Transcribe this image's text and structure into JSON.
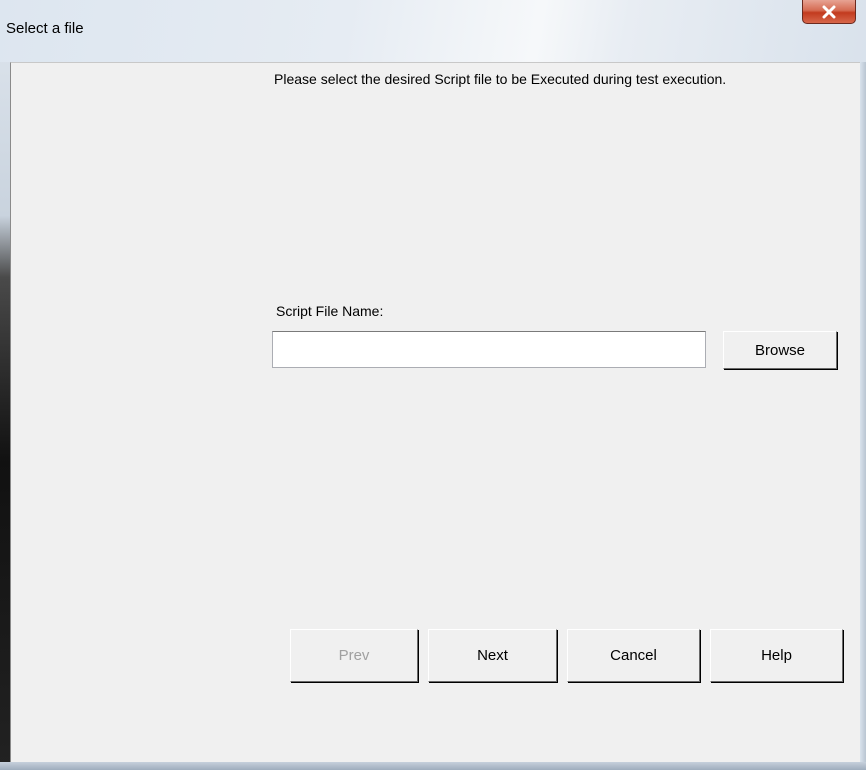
{
  "window": {
    "title": "Select a file",
    "close_icon": "close-icon"
  },
  "main": {
    "instructions": "Please select the desired Script file to be Executed during test execution.",
    "script_file": {
      "label": "Script File Name:",
      "value": "",
      "placeholder": ""
    },
    "browse_label": "Browse"
  },
  "footer": {
    "prev_label": "Prev",
    "next_label": "Next",
    "cancel_label": "Cancel",
    "help_label": "Help"
  },
  "colors": {
    "dialog_background": "#f0f0f0",
    "close_button": "#c23b1f",
    "disabled_text": "#a0a0a0"
  }
}
